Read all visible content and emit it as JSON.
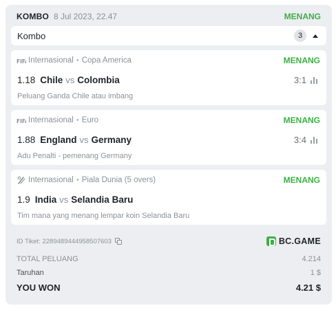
{
  "header": {
    "label": "KOMBO",
    "date": "8 Jul 2023, 22.47",
    "status": "MENANG"
  },
  "combo": {
    "title": "Kombo",
    "count": "3",
    "expanded": true
  },
  "bets": [
    {
      "league_icon": "fifa-icon",
      "category": "Internasional",
      "tournament": "Copa America",
      "result": "MENANG",
      "odds": "1.18",
      "team_a": "Chile",
      "vs": "vs",
      "team_b": "Colombia",
      "score": "3:1",
      "selection": "Peluang Ganda Chile atau imbang"
    },
    {
      "league_icon": "fifa-icon",
      "category": "Internasional",
      "tournament": "Euro",
      "result": "MENANG",
      "odds": "1.88",
      "team_a": "England",
      "vs": "vs",
      "team_b": "Germany",
      "score": "3:4",
      "selection": "Adu Penalti - pemenang Germany"
    },
    {
      "league_icon": "cricket-icon",
      "category": "Internasional",
      "tournament": "Piala Dunia (5 overs)",
      "result": "MENANG",
      "odds": "1.9",
      "team_a": "India",
      "vs": "vs",
      "team_b": "Selandia Baru",
      "score": "",
      "selection": "Tim mana yang menang lempar koin Selandia Baru"
    }
  ],
  "ticket": {
    "id_text": "ID Tiket: 2289489444958507603",
    "brand": "BC.GAME"
  },
  "summary": {
    "total_label": "TOTAL PELUANG",
    "total_value": "4.214",
    "stake_label": "Taruhan",
    "stake_value": "1 $",
    "won_label": "YOU WON",
    "won_value": "4.21 $"
  },
  "colors": {
    "win_green": "#3cb043",
    "panel_bg": "#eceef1",
    "text_dark": "#1f2329",
    "text_muted": "#8b9097"
  }
}
